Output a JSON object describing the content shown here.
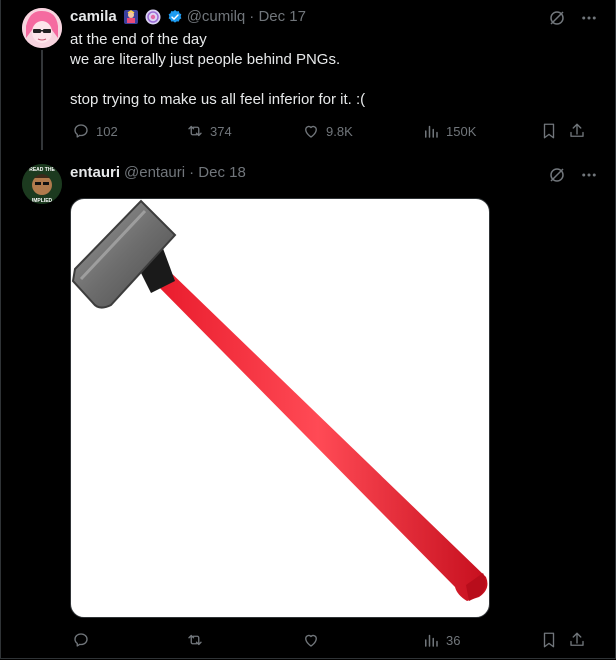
{
  "tweets": [
    {
      "author": {
        "name": "camila",
        "handle": "@cumilq",
        "date": "· Dec 17"
      },
      "lines": [
        "at the end of the day",
        "we are literally just people behind PNGs.",
        "",
        "stop trying to make us all feel inferior for it. :("
      ],
      "stats": {
        "replies": "102",
        "reposts": "374",
        "likes": "9.8K",
        "views": "150K"
      },
      "icons": [
        "grok-icon",
        "more-icon",
        "reply-icon",
        "repost-icon",
        "like-icon",
        "views-icon",
        "bookmark-icon",
        "share-icon"
      ]
    },
    {
      "author": {
        "name": "entauri",
        "handle": "@entauri",
        "date": "· Dec 18"
      },
      "avatar_text": {
        "top": "READ THE",
        "bottom": "IMPLIED"
      },
      "stats": {
        "replies": "",
        "reposts": "",
        "likes": "",
        "views": "36"
      },
      "media": {
        "subject": "sledgehammer-image"
      }
    }
  ],
  "colors": {
    "verified": "#1d9bf0",
    "handle": "#71767b",
    "text": "#e7e9ea",
    "handle_red": "#e0262f"
  }
}
